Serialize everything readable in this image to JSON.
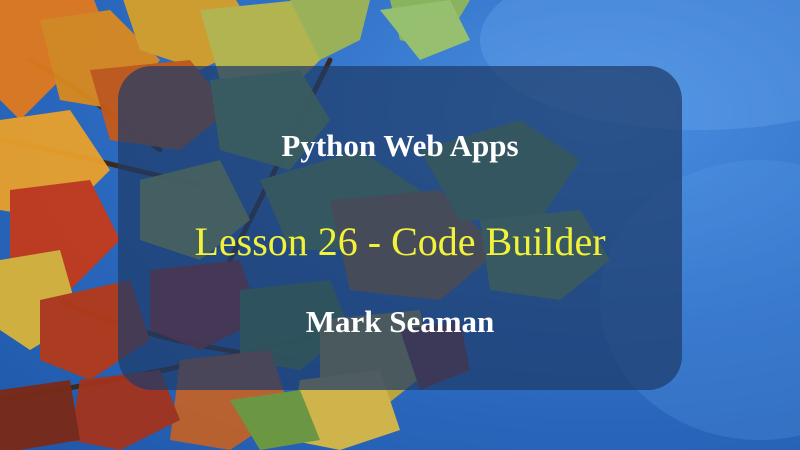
{
  "slide": {
    "series_title": "Python Web Apps",
    "lesson_title": "Lesson 26 - Code Builder",
    "author": "Mark Seaman"
  },
  "colors": {
    "sky": "#2f6fc6",
    "card": "#1e3c69",
    "series_title": "#ffffff",
    "lesson_title": "#f2f238",
    "author": "#ffffff"
  },
  "background": {
    "subject": "autumn-leaves-against-blue-sky"
  }
}
